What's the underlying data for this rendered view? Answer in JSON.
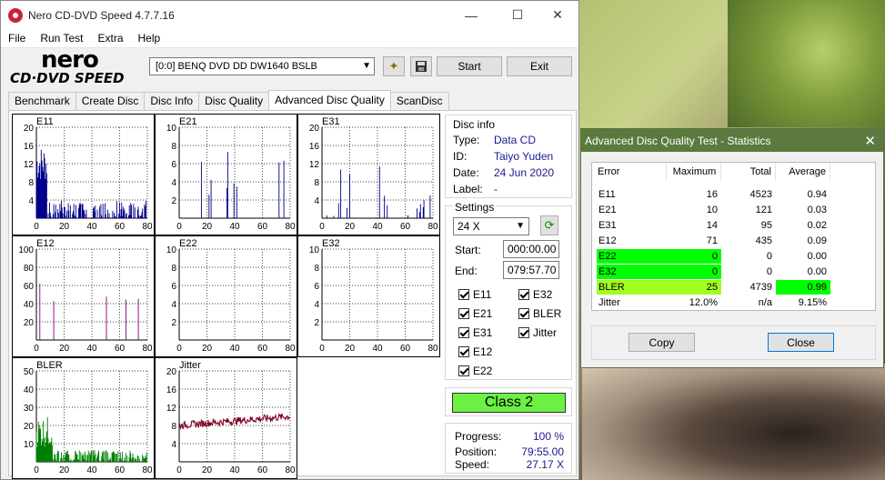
{
  "window": {
    "title": "Nero CD-DVD Speed 4.7.7.16",
    "minimize": "—",
    "maximize": "☐",
    "close": "✕"
  },
  "menu": [
    "File",
    "Run Test",
    "Extra",
    "Help"
  ],
  "logo": {
    "brand": "nero",
    "product": "CD·DVD SPEED"
  },
  "toolbar": {
    "drive": "[0:0]   BENQ DVD DD DW1640 BSLB",
    "start": "Start",
    "exit": "Exit"
  },
  "tabs": [
    "Benchmark",
    "Create Disc",
    "Disc Info",
    "Disc Quality",
    "Advanced Disc Quality",
    "ScanDisc"
  ],
  "active_tab": "Advanced Disc Quality",
  "chart_data": [
    {
      "type": "bar",
      "title": "E11",
      "x": [
        0,
        20,
        40,
        60,
        80
      ],
      "yticks": [
        4,
        8,
        12,
        16,
        20
      ],
      "ylim": [
        0,
        20
      ],
      "color": "#00008b"
    },
    {
      "type": "bar",
      "title": "E21",
      "x": [
        0,
        20,
        40,
        60,
        80
      ],
      "yticks": [
        2,
        4,
        6,
        8,
        10
      ],
      "ylim": [
        0,
        10
      ],
      "color": "#00008b"
    },
    {
      "type": "bar",
      "title": "E31",
      "x": [
        0,
        20,
        40,
        60,
        80
      ],
      "yticks": [
        4,
        8,
        12,
        16,
        20
      ],
      "ylim": [
        0,
        20
      ],
      "color": "#00008b"
    },
    {
      "type": "bar",
      "title": "E12",
      "x": [
        0,
        20,
        40,
        60,
        80
      ],
      "yticks": [
        20,
        40,
        60,
        80,
        100
      ],
      "ylim": [
        0,
        100
      ],
      "color": "#800080"
    },
    {
      "type": "bar",
      "title": "E22",
      "x": [
        0,
        20,
        40,
        60,
        80
      ],
      "yticks": [
        2,
        4,
        6,
        8,
        10
      ],
      "ylim": [
        0,
        10
      ],
      "color": "#800080"
    },
    {
      "type": "bar",
      "title": "E32",
      "x": [
        0,
        20,
        40,
        60,
        80
      ],
      "yticks": [
        2,
        4,
        6,
        8,
        10
      ],
      "ylim": [
        0,
        10
      ],
      "color": "#800080"
    },
    {
      "type": "bar",
      "title": "BLER",
      "x": [
        0,
        20,
        40,
        60,
        80
      ],
      "yticks": [
        10,
        20,
        30,
        40,
        50
      ],
      "ylim": [
        0,
        50
      ],
      "color": "#008000"
    },
    {
      "type": "line",
      "title": "Jitter",
      "x": [
        0,
        20,
        40,
        60,
        80
      ],
      "yticks": [
        4,
        8,
        12,
        16,
        20
      ],
      "ylim": [
        0,
        20
      ],
      "color": "#800020"
    }
  ],
  "disc_info": {
    "heading": "Disc info",
    "type_label": "Type:",
    "type": "Data CD",
    "id_label": "ID:",
    "id": "Taiyo Yuden",
    "date_label": "Date:",
    "date": "24 Jun 2020",
    "label_label": "Label:",
    "label": "-"
  },
  "settings": {
    "heading": "Settings",
    "speed": "24 X",
    "start_label": "Start:",
    "start": "000:00.00",
    "end_label": "End:",
    "end": "079:57.70"
  },
  "checks": [
    "E11",
    "E32",
    "E21",
    "BLER",
    "E31",
    "Jitter",
    "E12",
    "E22"
  ],
  "class": "Class 2",
  "progress": {
    "progress_label": "Progress:",
    "progress": "100 %",
    "position_label": "Position:",
    "position": "79:55.00",
    "speed_label": "Speed:",
    "speed": "27.17 X"
  },
  "stats": {
    "title": "Advanced Disc Quality Test - Statistics",
    "headers": [
      "Error",
      "Maximum",
      "Total",
      "Average"
    ],
    "rows": [
      [
        "E11",
        "16",
        "4523",
        "0.94"
      ],
      [
        "E21",
        "10",
        "121",
        "0.03"
      ],
      [
        "E31",
        "14",
        "95",
        "0.02"
      ],
      [
        "E12",
        "71",
        "435",
        "0.09"
      ],
      [
        "E22",
        "0",
        "0",
        "0.00"
      ],
      [
        "E32",
        "0",
        "0",
        "0.00"
      ],
      [
        "BLER",
        "25",
        "4739",
        "0.99"
      ],
      [
        "Jitter",
        "12.0%",
        "n/a",
        "9.15%"
      ]
    ],
    "copy": "Copy",
    "close": "Close",
    "colors": {
      "green": "#00ff00",
      "yellow_green": "#a0ff20"
    }
  }
}
